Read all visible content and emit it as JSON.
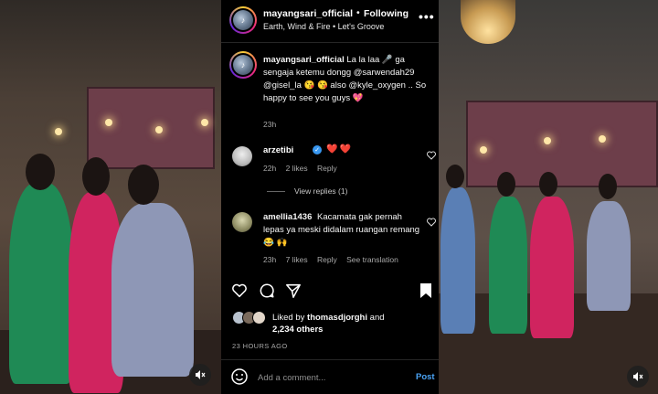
{
  "post": {
    "username": "mayangsari_official",
    "follow_dot": "•",
    "follow_label": "Following",
    "song": "Earth, Wind & Fire • Let's Groove",
    "more_label": "•••"
  },
  "caption": {
    "username": "mayangsari_official",
    "text": "La la laa 🎤 ga sengaja ketemu dongg @sarwendah29 @gisel_la 😘 😘 also @kyle_oxygen .. So happy to see you guys 💖",
    "time": "23h"
  },
  "comments": [
    {
      "username": "arzetibi",
      "verified": "✓",
      "text": "❤️❤️",
      "time": "22h",
      "likes": "2 likes",
      "reply": "Reply",
      "view_replies": "View replies (1)"
    },
    {
      "username": "amellia1436",
      "text": "Kacamata gak pernah lepas ya meski didalam ruangan remang 😂 🙌",
      "time": "23h",
      "likes": "7 likes",
      "reply": "Reply",
      "translation": "See translation"
    }
  ],
  "likes": {
    "prefix": "Liked by",
    "user": "thomasdjorghi",
    "and": "and",
    "others": "2,234 others"
  },
  "post_time": "23 HOURS AGO",
  "comment_box": {
    "placeholder": "Add a comment...",
    "post_label": "Post"
  },
  "icons": {
    "heart": "heart-icon",
    "comment": "comment-icon",
    "share": "share-icon",
    "bookmark": "bookmark-icon",
    "mute": "mute-icon",
    "emoji": "emoji-icon"
  },
  "colors": {
    "background": "#000000",
    "link": "#4aa3f5",
    "verified": "#3897f0",
    "muted_text": "#a8a8a8"
  }
}
